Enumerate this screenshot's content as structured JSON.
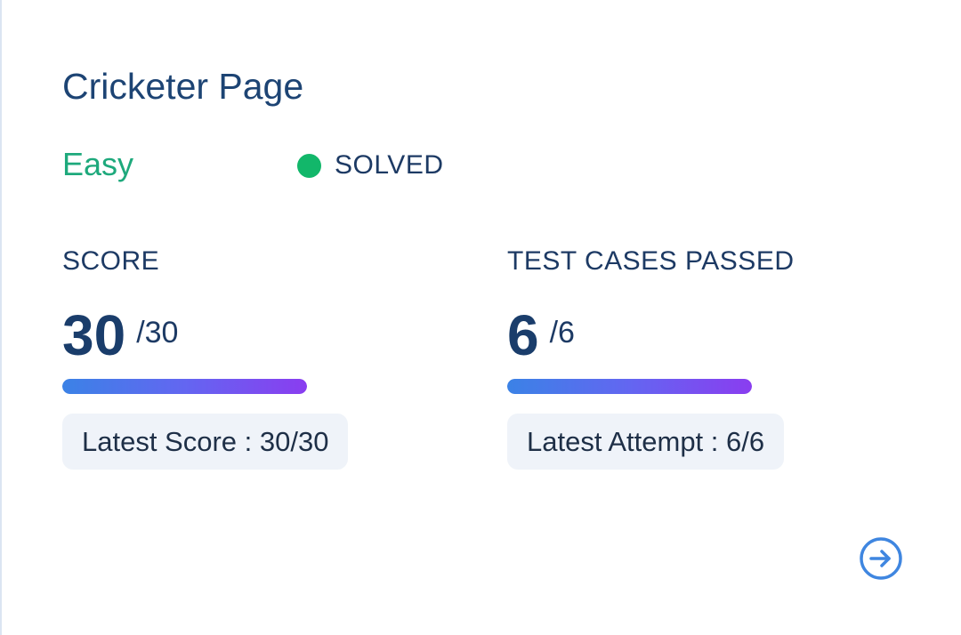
{
  "card": {
    "title": "Cricketer Page",
    "difficulty": "Easy",
    "status": "SOLVED"
  },
  "score": {
    "label": "SCORE",
    "value": "30",
    "total": "/30",
    "progress_percent": 100,
    "latest": "Latest Score : 30/30"
  },
  "tests": {
    "label": "TEST CASES PASSED",
    "value": "6",
    "total": "/6",
    "progress_percent": 100,
    "latest": "Latest Attempt : 6/6"
  },
  "icons": {
    "status_dot": "status-dot-icon",
    "open": "arrow-right-circle-icon"
  },
  "colors": {
    "title": "#1d4474",
    "difficulty_easy": "#1ea97c",
    "status_solved": "#12b76a",
    "progress_start": "#3b82e6",
    "progress_end": "#8a3df0",
    "arrow": "#3f86e0"
  }
}
